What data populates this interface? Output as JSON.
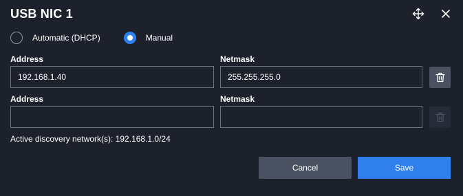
{
  "dialog": {
    "title": "USB NIC 1",
    "icons": {
      "move": "move-icon",
      "close": "close-icon"
    }
  },
  "mode": {
    "options": [
      {
        "label": "Automatic (DHCP)",
        "selected": false
      },
      {
        "label": "Manual",
        "selected": true
      }
    ]
  },
  "rows": [
    {
      "address_label": "Address",
      "netmask_label": "Netmask",
      "address_value": "192.168.1.40",
      "netmask_value": "255.255.255.0",
      "delete_enabled": true
    },
    {
      "address_label": "Address",
      "netmask_label": "Netmask",
      "address_value": "",
      "netmask_value": "",
      "delete_enabled": false
    }
  ],
  "discovery": {
    "text": "Active discovery network(s): 192.168.1.0/24"
  },
  "actions": {
    "cancel_label": "Cancel",
    "save_label": "Save"
  },
  "colors": {
    "background": "#1c212b",
    "accent": "#2f80ed",
    "secondary_button": "#4a5262",
    "field_border": "#6b7382"
  }
}
